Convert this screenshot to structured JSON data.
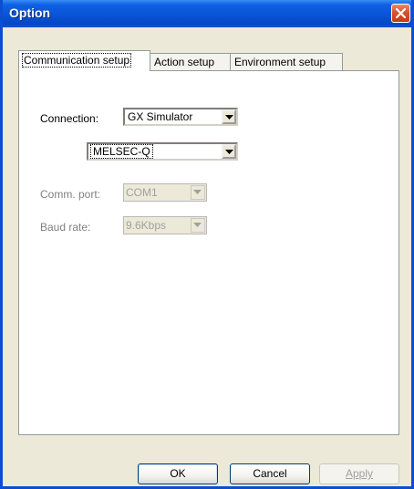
{
  "window": {
    "title": "Option"
  },
  "tabs": [
    {
      "label": "Communication setup",
      "active": true
    },
    {
      "label": "Action setup",
      "active": false
    },
    {
      "label": "Environment setup",
      "active": false
    }
  ],
  "form": {
    "connection_label": "Connection:",
    "connection_value": "GX Simulator",
    "plc_series_value": "MELSEC-Q",
    "comm_port_label": "Comm. port:",
    "comm_port_value": "COM1",
    "baud_rate_label": "Baud rate:",
    "baud_rate_value": "9.6Kbps"
  },
  "buttons": {
    "ok": "OK",
    "cancel": "Cancel",
    "apply": "Apply"
  },
  "icons": {
    "close": "close-icon",
    "dropdown": "chevron-down-icon"
  },
  "colors": {
    "title_bar": "#0a54d6",
    "close_button": "#d9532c",
    "dialog_bg": "#ece9d8",
    "panel_bg": "#ffffff"
  }
}
